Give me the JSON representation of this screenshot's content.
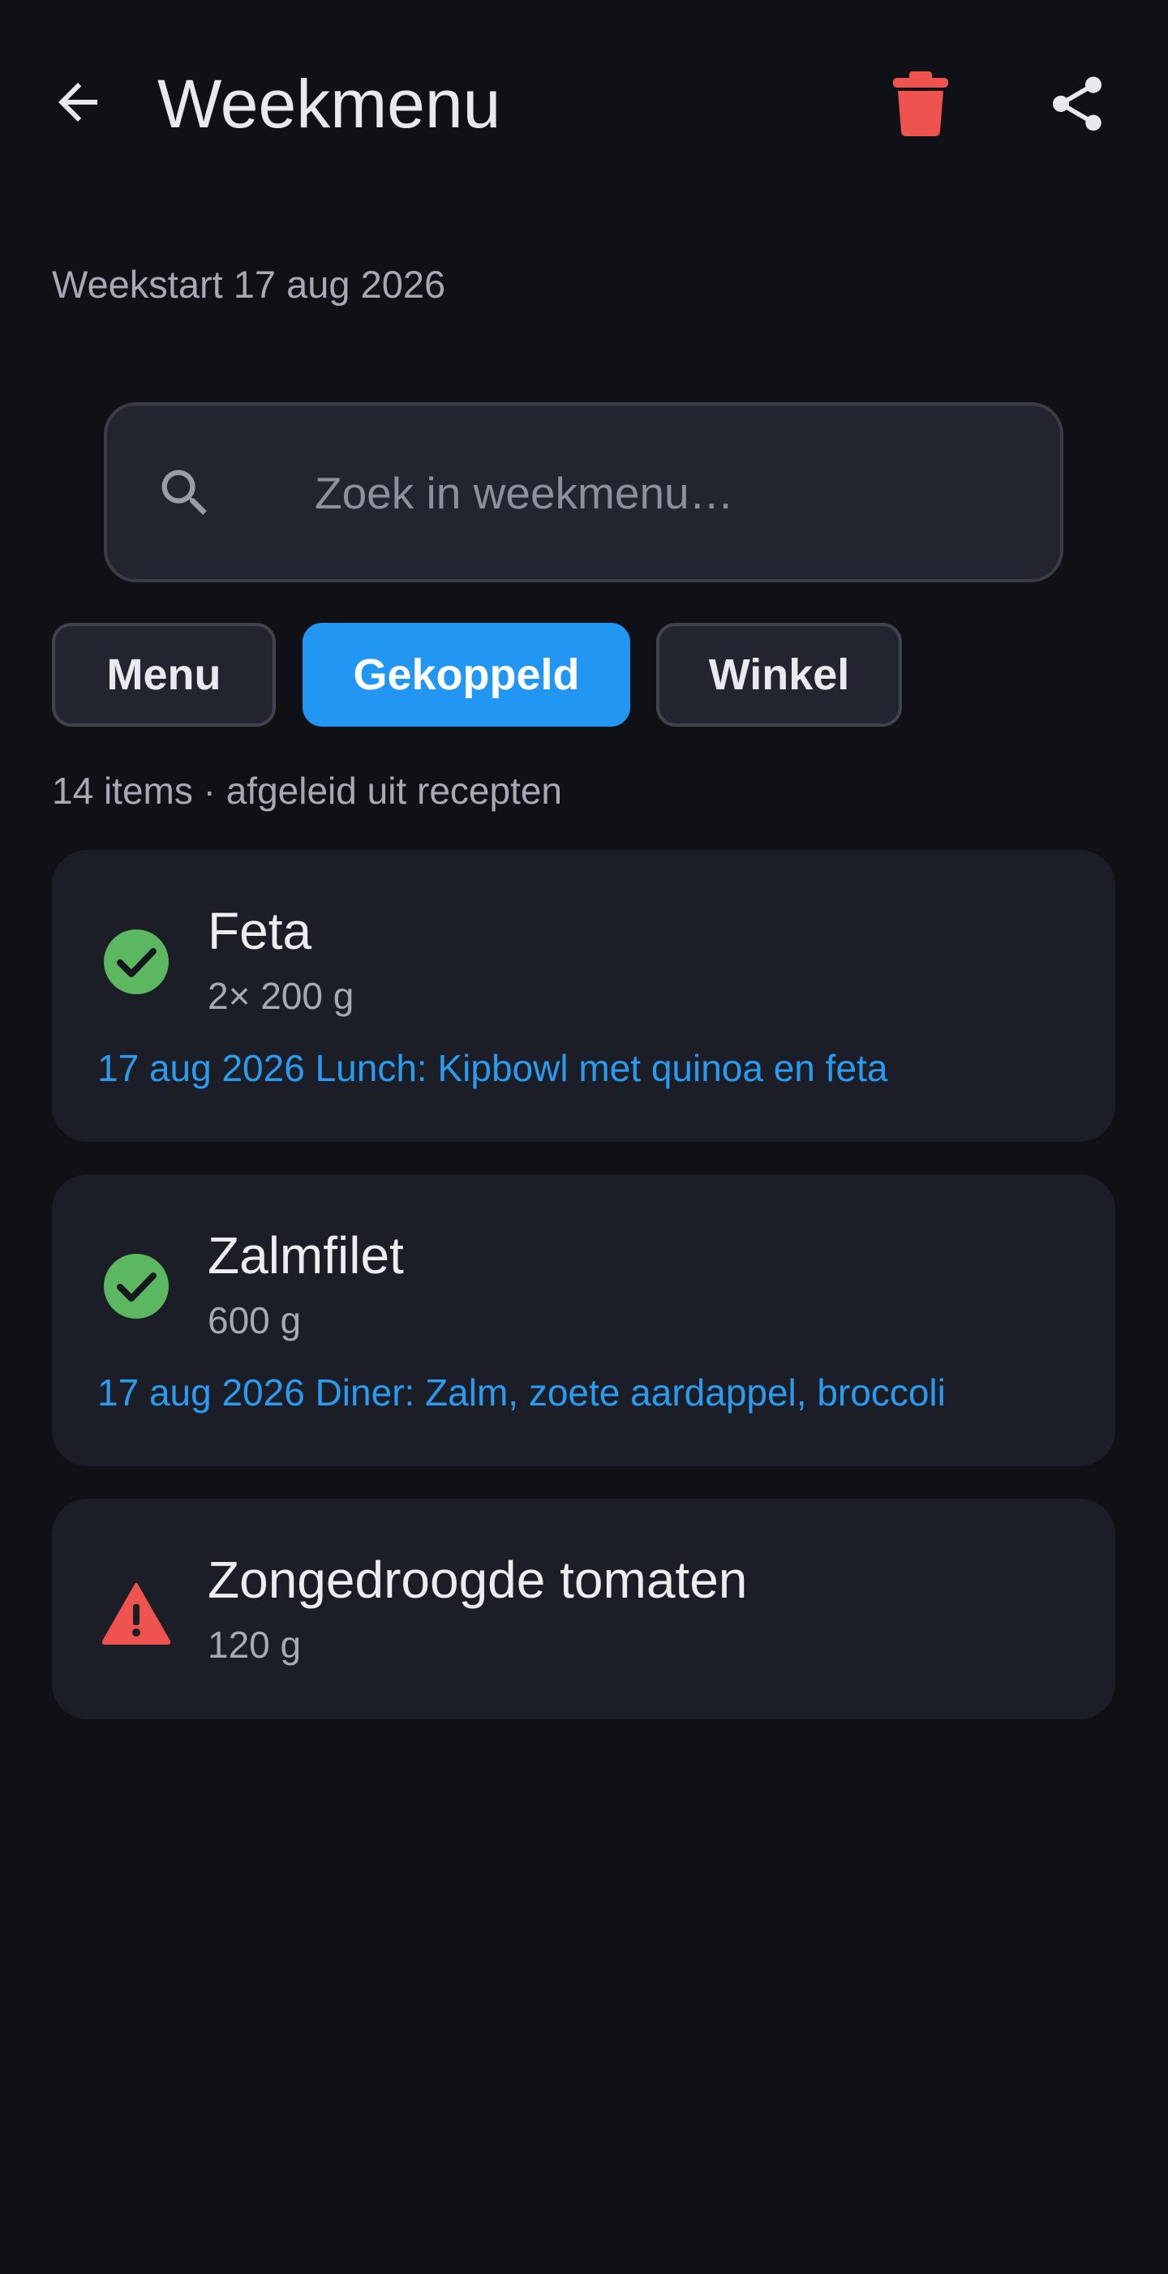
{
  "header": {
    "title": "Weekmenu",
    "back_icon": "arrow-back-icon",
    "delete_icon": "trash-icon",
    "share_icon": "share-icon",
    "delete_color": "#ef5350"
  },
  "weekstart": "Weekstart 17 aug 2026",
  "search": {
    "placeholder": "Zoek in weekmenu…",
    "value": ""
  },
  "tabs": [
    {
      "label": "Menu",
      "selected": false
    },
    {
      "label": "Gekoppeld",
      "selected": true
    },
    {
      "label": "Winkel",
      "selected": false
    }
  ],
  "accent_color": "#2196f3",
  "summary": "14 items · afgeleid uit recepten",
  "items": [
    {
      "name": "Feta",
      "quantity": "2× 200 g",
      "status": "linked",
      "status_icon": "check-circle-icon",
      "status_color": "#5cb860",
      "recipe_link": "17 aug 2026 Lunch: Kipbowl met quinoa en feta"
    },
    {
      "name": "Zalmfilet",
      "quantity": "600 g",
      "status": "linked",
      "status_icon": "check-circle-icon",
      "status_color": "#5cb860",
      "recipe_link": "17 aug 2026 Diner: Zalm, zoete aardappel, broccoli"
    },
    {
      "name": "Zongedroogde tomaten",
      "quantity": "120 g",
      "status": "warning",
      "status_icon": "warning-triangle-icon",
      "status_color": "#ef5350"
    }
  ]
}
